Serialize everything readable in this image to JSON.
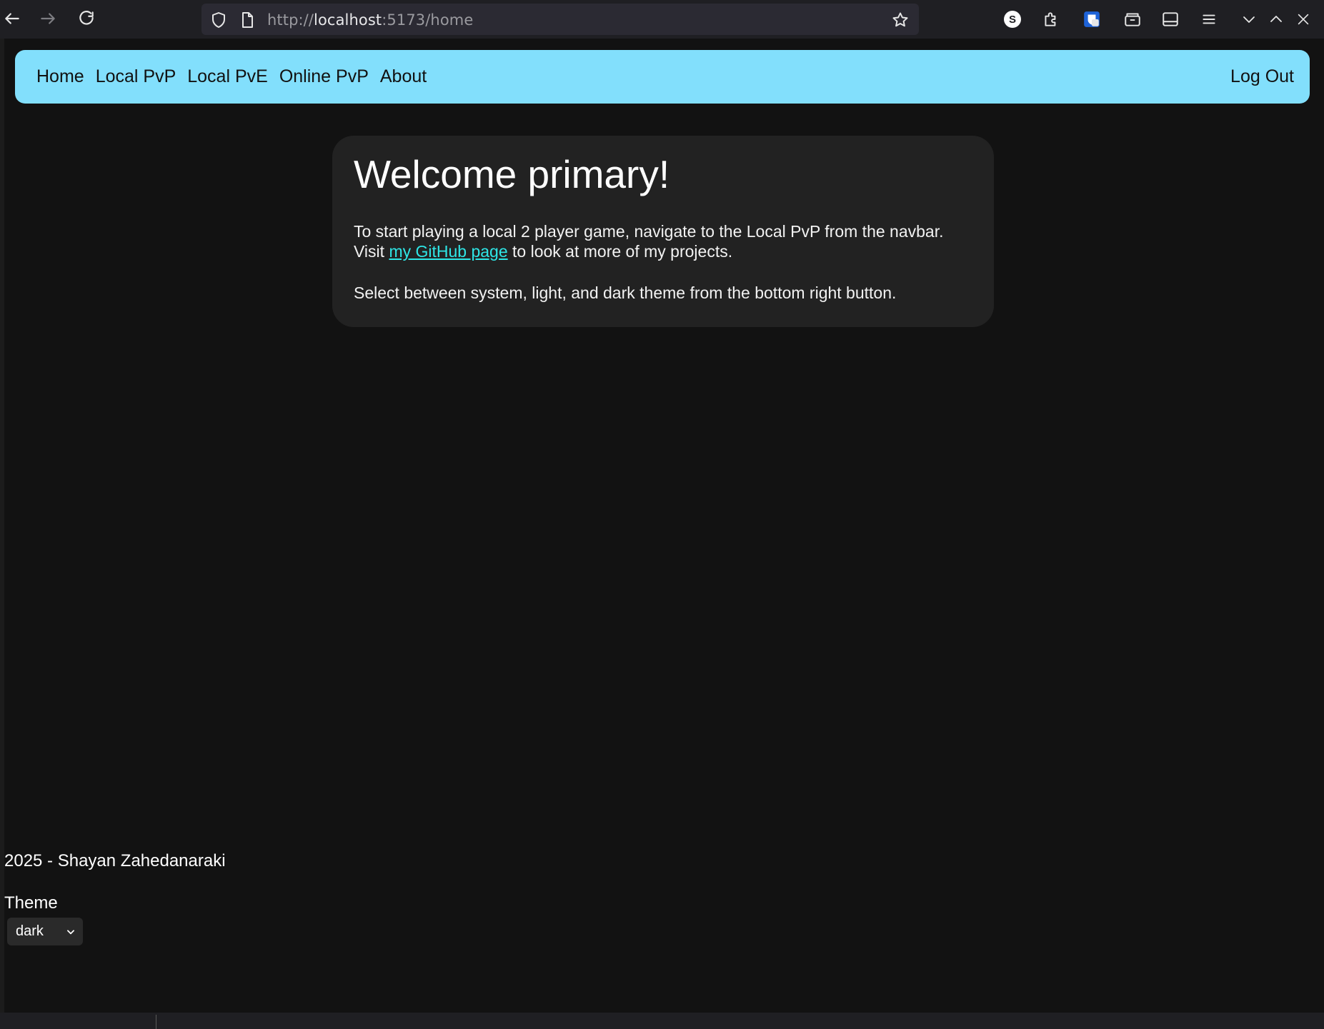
{
  "browser": {
    "url_scheme": "http://",
    "url_host": "localhost",
    "url_rest": ":5173/home",
    "profile_initial": "S"
  },
  "navbar": {
    "links": [
      {
        "label": "Home"
      },
      {
        "label": "Local PvP"
      },
      {
        "label": "Local PvE"
      },
      {
        "label": "Online PvP"
      },
      {
        "label": "About"
      }
    ],
    "logout_label": "Log Out",
    "background_color": "#82dffc"
  },
  "welcome": {
    "title": "Welcome primary!",
    "line1": "To start playing a local 2 player game, navigate to the Local PvP from the navbar.",
    "visit_prefix": "Visit ",
    "github_link_text": "my GitHub page",
    "visit_suffix": " to look at more of my projects.",
    "theme_hint": "Select between system, light, and dark theme from the bottom right button.",
    "link_color": "#2ee6e6"
  },
  "footer": {
    "credit": "2025 - Shayan Zahedanaraki",
    "theme_label": "Theme",
    "theme_selected": "dark"
  }
}
